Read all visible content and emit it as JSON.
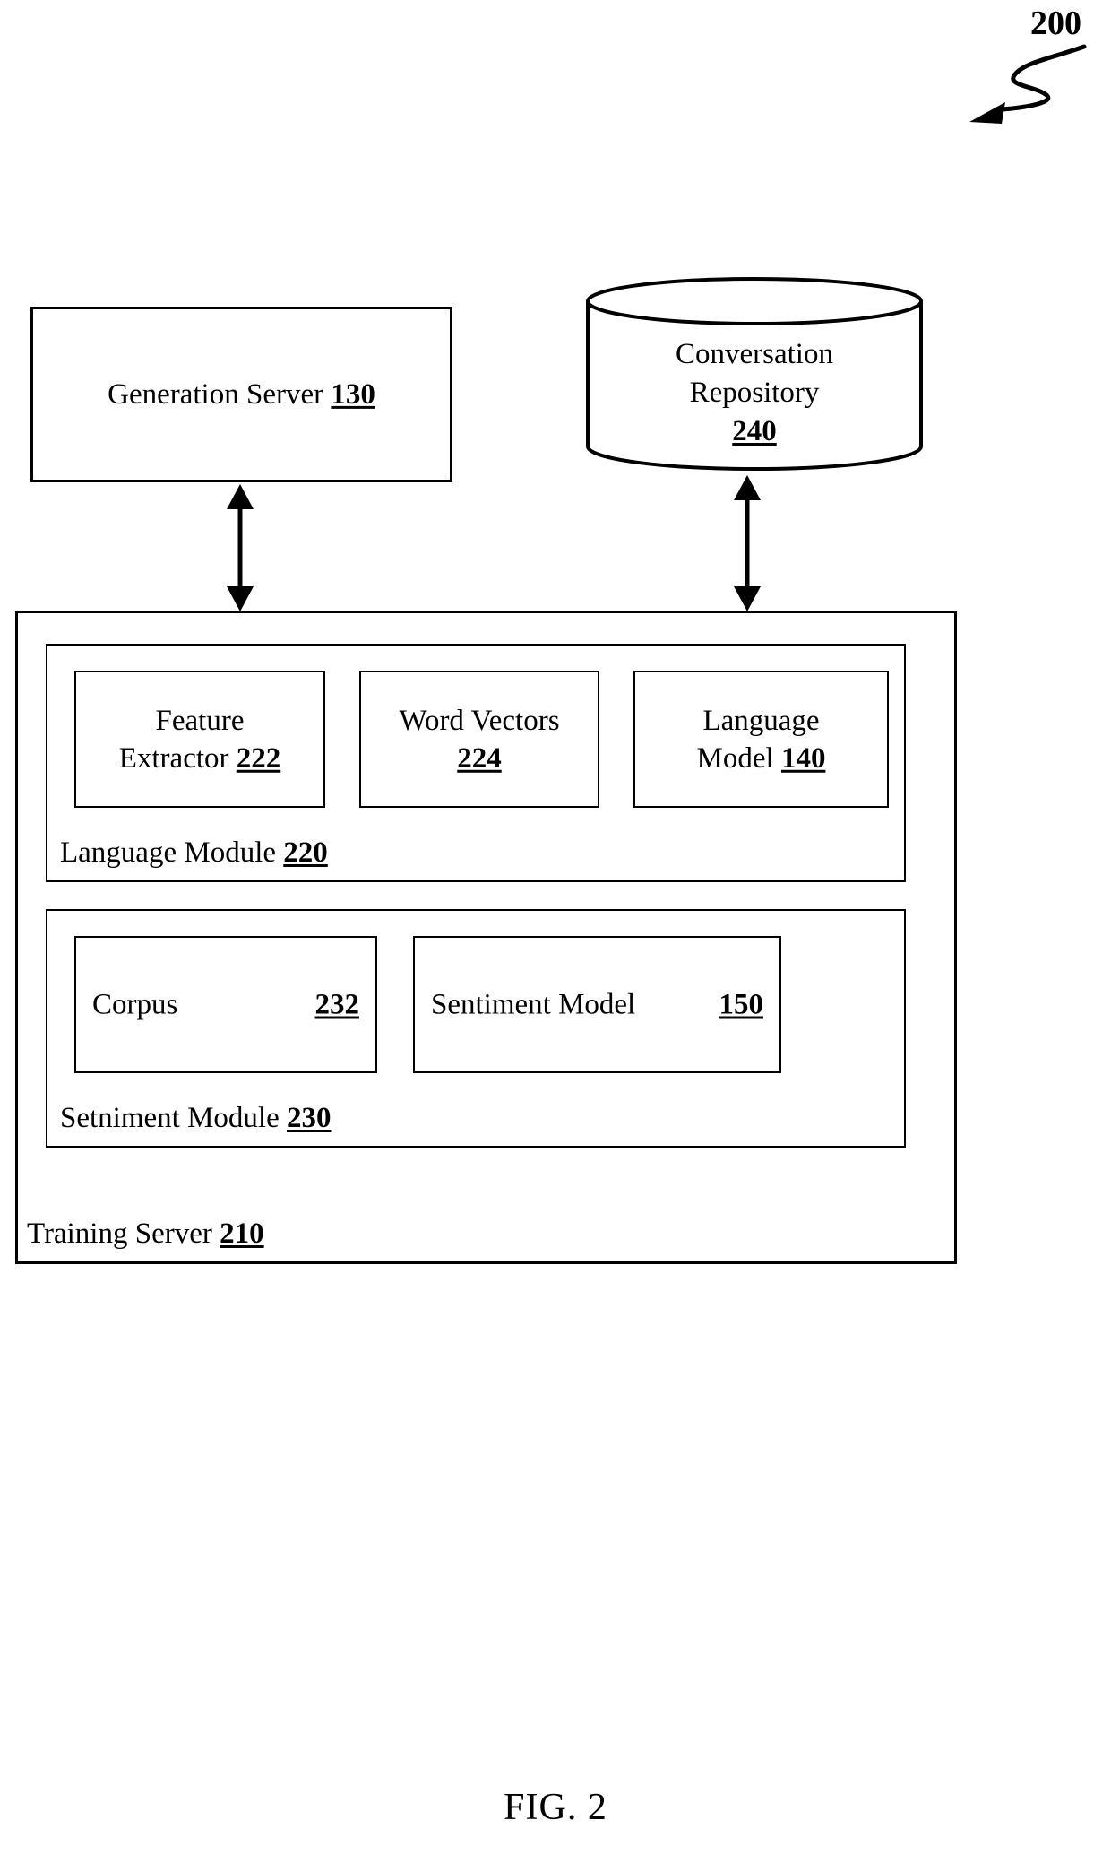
{
  "figure": {
    "caption": "FIG. 2",
    "lead_number": "200"
  },
  "nodes": {
    "generation_server": {
      "label": "Generation Server",
      "ref": "130"
    },
    "conversation_repository": {
      "label_line1": "Conversation",
      "label_line2": "Repository",
      "ref": "240"
    },
    "training_server": {
      "label": "Training Server",
      "ref": "210"
    },
    "language_module": {
      "label": "Language Module",
      "ref": "220",
      "children": [
        {
          "label_line1": "Feature",
          "label_line2": "Extractor",
          "ref": "222"
        },
        {
          "label_line1": "Word Vectors",
          "label_line2": "",
          "ref": "224"
        },
        {
          "label_line1": "Language",
          "label_line2": "Model",
          "ref": "140"
        }
      ]
    },
    "sentiment_module": {
      "label": "Setniment Module",
      "ref": "230",
      "children": [
        {
          "label": "Corpus",
          "ref": "232"
        },
        {
          "label": "Sentiment Model",
          "ref": "150"
        }
      ]
    }
  },
  "connectors": [
    {
      "name": "generation-server-to-training-server",
      "style": "double-headed-vertical"
    },
    {
      "name": "conversation-repository-to-training-server",
      "style": "double-headed-vertical"
    }
  ],
  "colors": {
    "stroke": "#000000",
    "background": "#ffffff"
  }
}
